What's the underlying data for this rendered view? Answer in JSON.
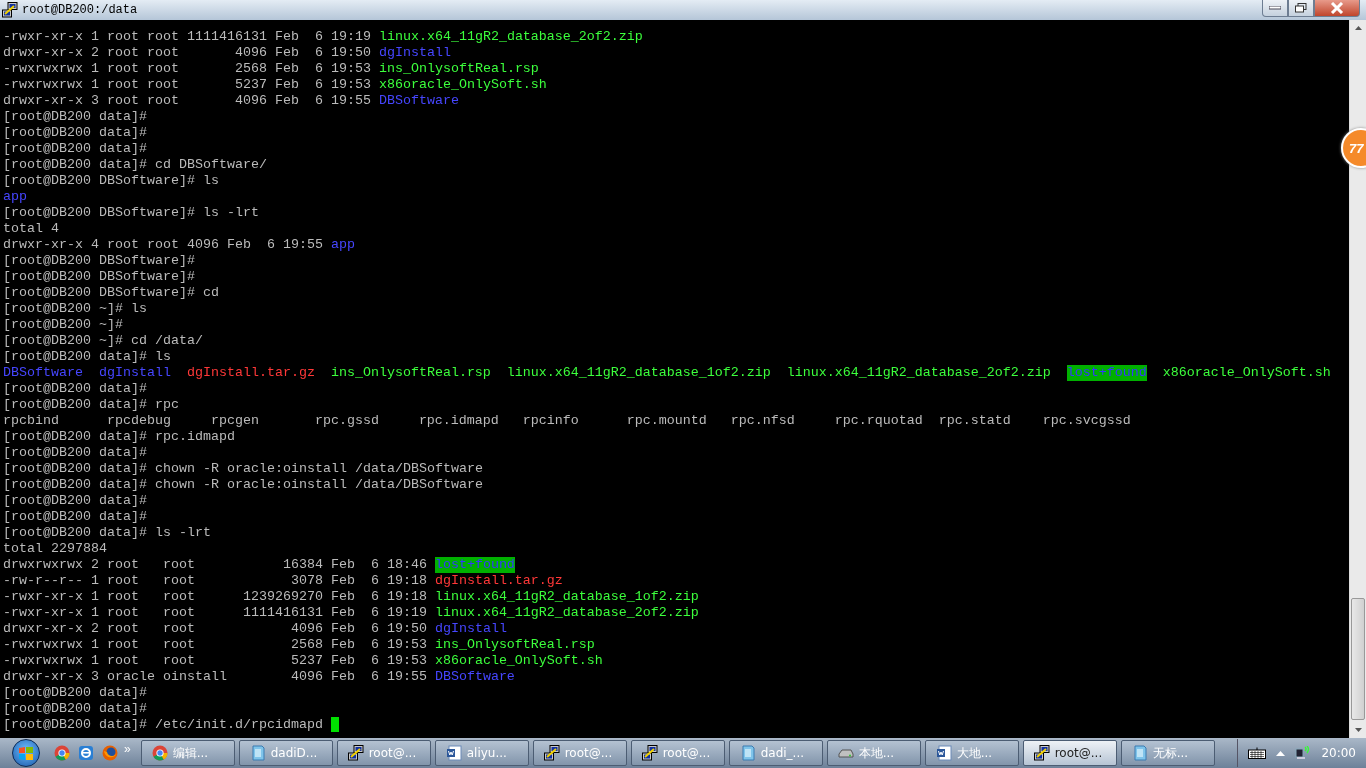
{
  "window": {
    "title": "root@DB200:/data"
  },
  "terminal": {
    "cursor": true,
    "lines": [
      {
        "kind": "listing",
        "segments": [
          {
            "text": "-rwxr-xr-x 1 root root 1111416131 Feb  6 19:19",
            "kind": "plain"
          },
          {
            "text": "linux.x64_11gR2_database_2of2.zip",
            "kind": "executable"
          }
        ]
      },
      {
        "kind": "listing",
        "segments": [
          {
            "text": "drwxr-xr-x 2 root root       4096 Feb  6 19:50",
            "kind": "plain"
          },
          {
            "text": "dgInstall",
            "kind": "directory"
          }
        ]
      },
      {
        "kind": "listing",
        "segments": [
          {
            "text": "-rwxrwxrwx 1 root root       2568 Feb  6 19:53",
            "kind": "plain"
          },
          {
            "text": "ins_OnlysoftReal.rsp",
            "kind": "executable"
          }
        ]
      },
      {
        "kind": "listing",
        "segments": [
          {
            "text": "-rwxrwxrwx 1 root root       5237 Feb  6 19:53",
            "kind": "plain"
          },
          {
            "text": "x86oracle_OnlySoft.sh",
            "kind": "executable"
          }
        ]
      },
      {
        "kind": "listing",
        "segments": [
          {
            "text": "drwxr-xr-x 3 root root       4096 Feb  6 19:55",
            "kind": "plain"
          },
          {
            "text": "DBSoftware",
            "kind": "directory"
          }
        ]
      },
      {
        "kind": "listing",
        "segments": [
          {
            "text": "[root@DB200 data]#",
            "kind": "plain"
          }
        ]
      },
      {
        "kind": "listing",
        "segments": [
          {
            "text": "[root@DB200 data]#",
            "kind": "plain"
          }
        ]
      },
      {
        "kind": "listing",
        "segments": [
          {
            "text": "[root@DB200 data]#",
            "kind": "plain"
          }
        ]
      },
      {
        "kind": "listing",
        "segments": [
          {
            "text": "[root@DB200 data]# cd DBSoftware/",
            "kind": "plain"
          }
        ]
      },
      {
        "kind": "listing",
        "segments": [
          {
            "text": "[root@DB200 DBSoftware]# ls",
            "kind": "plain"
          }
        ]
      },
      {
        "kind": "listing",
        "segments": [
          {
            "text": "app",
            "kind": "directory"
          }
        ]
      },
      {
        "kind": "listing",
        "segments": [
          {
            "text": "[root@DB200 DBSoftware]# ls -lrt",
            "kind": "plain"
          }
        ]
      },
      {
        "kind": "listing",
        "segments": [
          {
            "text": "total 4",
            "kind": "plain"
          }
        ]
      },
      {
        "kind": "listing",
        "segments": [
          {
            "text": "drwxr-xr-x 4 root root 4096 Feb  6 19:55",
            "kind": "plain"
          },
          {
            "text": "app",
            "kind": "directory"
          }
        ]
      },
      {
        "kind": "listing",
        "segments": [
          {
            "text": "[root@DB200 DBSoftware]#",
            "kind": "plain"
          }
        ]
      },
      {
        "kind": "listing",
        "segments": [
          {
            "text": "[root@DB200 DBSoftware]#",
            "kind": "plain"
          }
        ]
      },
      {
        "kind": "listing",
        "segments": [
          {
            "text": "[root@DB200 DBSoftware]# cd",
            "kind": "plain"
          }
        ]
      },
      {
        "kind": "listing",
        "segments": [
          {
            "text": "[root@DB200 ~]# ls",
            "kind": "plain"
          }
        ]
      },
      {
        "kind": "listing",
        "segments": [
          {
            "text": "[root@DB200 ~]#",
            "kind": "plain"
          }
        ]
      },
      {
        "kind": "listing",
        "segments": [
          {
            "text": "[root@DB200 ~]# cd /data/",
            "kind": "plain"
          }
        ]
      },
      {
        "kind": "listing",
        "segments": [
          {
            "text": "[root@DB200 data]# ls",
            "kind": "plain"
          }
        ]
      },
      {
        "kind": "columns",
        "segments": [
          {
            "text": "DBSoftware",
            "kind": "directory"
          },
          {
            "text": "dgInstall",
            "kind": "directory"
          },
          {
            "text": "dgInstall.tar.gz",
            "kind": "archive"
          },
          {
            "text": "ins_OnlysoftReal.rsp",
            "kind": "executable"
          },
          {
            "text": "linux.x64_11gR2_database_1of2.zip",
            "kind": "executable"
          },
          {
            "text": "linux.x64_11gR2_database_2of2.zip",
            "kind": "executable"
          },
          {
            "text": "lost+found",
            "kind": "sticky"
          },
          {
            "text": "x86oracle_OnlySoft.sh",
            "kind": "executable"
          }
        ]
      },
      {
        "kind": "listing",
        "segments": [
          {
            "text": "[root@DB200 data]#",
            "kind": "plain"
          }
        ]
      },
      {
        "kind": "listing",
        "segments": [
          {
            "text": "[root@DB200 data]# rpc",
            "kind": "plain"
          }
        ]
      },
      {
        "kind": "grid",
        "segments": [
          {
            "text": "rpcbind",
            "kind": "plain"
          },
          {
            "text": "rpcdebug",
            "kind": "plain"
          },
          {
            "text": "rpcgen",
            "kind": "plain"
          },
          {
            "text": "rpc.gssd",
            "kind": "plain"
          },
          {
            "text": "rpc.idmapd",
            "kind": "plain"
          },
          {
            "text": "rpcinfo",
            "kind": "plain"
          },
          {
            "text": "rpc.mountd",
            "kind": "plain"
          },
          {
            "text": "rpc.nfsd",
            "kind": "plain"
          },
          {
            "text": "rpc.rquotad",
            "kind": "plain"
          },
          {
            "text": "rpc.statd",
            "kind": "plain"
          },
          {
            "text": "rpc.svcgssd",
            "kind": "plain"
          }
        ]
      },
      {
        "kind": "listing",
        "segments": [
          {
            "text": "[root@DB200 data]# rpc.idmapd",
            "kind": "plain"
          }
        ]
      },
      {
        "kind": "listing",
        "segments": [
          {
            "text": "[root@DB200 data]#",
            "kind": "plain"
          }
        ]
      },
      {
        "kind": "listing",
        "segments": [
          {
            "text": "[root@DB200 data]# chown -R oracle:oinstall /data/DBSoftware",
            "kind": "plain"
          }
        ]
      },
      {
        "kind": "listing",
        "segments": [
          {
            "text": "[root@DB200 data]# chown -R oracle:oinstall /data/DBSoftware",
            "kind": "plain"
          }
        ]
      },
      {
        "kind": "listing",
        "segments": [
          {
            "text": "[root@DB200 data]#",
            "kind": "plain"
          }
        ]
      },
      {
        "kind": "listing",
        "segments": [
          {
            "text": "[root@DB200 data]#",
            "kind": "plain"
          }
        ]
      },
      {
        "kind": "listing",
        "segments": [
          {
            "text": "[root@DB200 data]# ls -lrt",
            "kind": "plain"
          }
        ]
      },
      {
        "kind": "listing",
        "segments": [
          {
            "text": "total 2297884",
            "kind": "plain"
          }
        ]
      },
      {
        "kind": "listing",
        "segments": [
          {
            "text": "drwxrwxrwx 2 root   root           16384 Feb  6 18:46",
            "kind": "plain"
          },
          {
            "text": "lost+found",
            "kind": "sticky"
          }
        ]
      },
      {
        "kind": "listing",
        "segments": [
          {
            "text": "-rw-r--r-- 1 root   root            3078 Feb  6 19:18",
            "kind": "plain"
          },
          {
            "text": "dgInstall.tar.gz",
            "kind": "archive"
          }
        ]
      },
      {
        "kind": "listing",
        "segments": [
          {
            "text": "-rwxr-xr-x 1 root   root      1239269270 Feb  6 19:18",
            "kind": "plain"
          },
          {
            "text": "linux.x64_11gR2_database_1of2.zip",
            "kind": "executable"
          }
        ]
      },
      {
        "kind": "listing",
        "segments": [
          {
            "text": "-rwxr-xr-x 1 root   root      1111416131 Feb  6 19:19",
            "kind": "plain"
          },
          {
            "text": "linux.x64_11gR2_database_2of2.zip",
            "kind": "executable"
          }
        ]
      },
      {
        "kind": "listing",
        "segments": [
          {
            "text": "drwxr-xr-x 2 root   root            4096 Feb  6 19:50",
            "kind": "plain"
          },
          {
            "text": "dgInstall",
            "kind": "directory"
          }
        ]
      },
      {
        "kind": "listing",
        "segments": [
          {
            "text": "-rwxrwxrwx 1 root   root            2568 Feb  6 19:53",
            "kind": "plain"
          },
          {
            "text": "ins_OnlysoftReal.rsp",
            "kind": "executable"
          }
        ]
      },
      {
        "kind": "listing",
        "segments": [
          {
            "text": "-rwxrwxrwx 1 root   root            5237 Feb  6 19:53",
            "kind": "plain"
          },
          {
            "text": "x86oracle_OnlySoft.sh",
            "kind": "executable"
          }
        ]
      },
      {
        "kind": "listing",
        "segments": [
          {
            "text": "drwxr-xr-x 3 oracle oinstall        4096 Feb  6 19:55",
            "kind": "plain"
          },
          {
            "text": "DBSoftware",
            "kind": "directory"
          }
        ]
      },
      {
        "kind": "listing",
        "segments": [
          {
            "text": "[root@DB200 data]#",
            "kind": "plain"
          }
        ]
      },
      {
        "kind": "listing",
        "segments": [
          {
            "text": "[root@DB200 data]#",
            "kind": "plain"
          }
        ]
      },
      {
        "kind": "listing",
        "segments": [
          {
            "text": "[root@DB200 data]# /etc/init.d/rpcidmapd",
            "kind": "plain"
          }
        ]
      }
    ]
  },
  "floating_badge": {
    "text": "77"
  },
  "taskbar": {
    "more": "»",
    "clock": "20:00",
    "quick_launch": [
      {
        "kind": "chrome"
      },
      {
        "kind": "ie"
      },
      {
        "kind": "firefox"
      }
    ],
    "tasks": [
      {
        "kind": "chrome",
        "label": "编辑...",
        "selected": false
      },
      {
        "kind": "notepad",
        "label": "dadiD...",
        "selected": false
      },
      {
        "kind": "putty",
        "label": "root@...",
        "selected": false
      },
      {
        "kind": "word",
        "label": "aliyu...",
        "selected": false
      },
      {
        "kind": "putty",
        "label": "root@...",
        "selected": false
      },
      {
        "kind": "putty",
        "label": "root@...",
        "selected": false
      },
      {
        "kind": "notepad",
        "label": "dadi_...",
        "selected": false
      },
      {
        "kind": "drive",
        "label": "本地...",
        "selected": false
      },
      {
        "kind": "word",
        "label": "大地...",
        "selected": false
      },
      {
        "kind": "putty",
        "label": "root@...",
        "selected": true
      },
      {
        "kind": "notepad",
        "label": "无标...",
        "selected": false
      }
    ]
  }
}
